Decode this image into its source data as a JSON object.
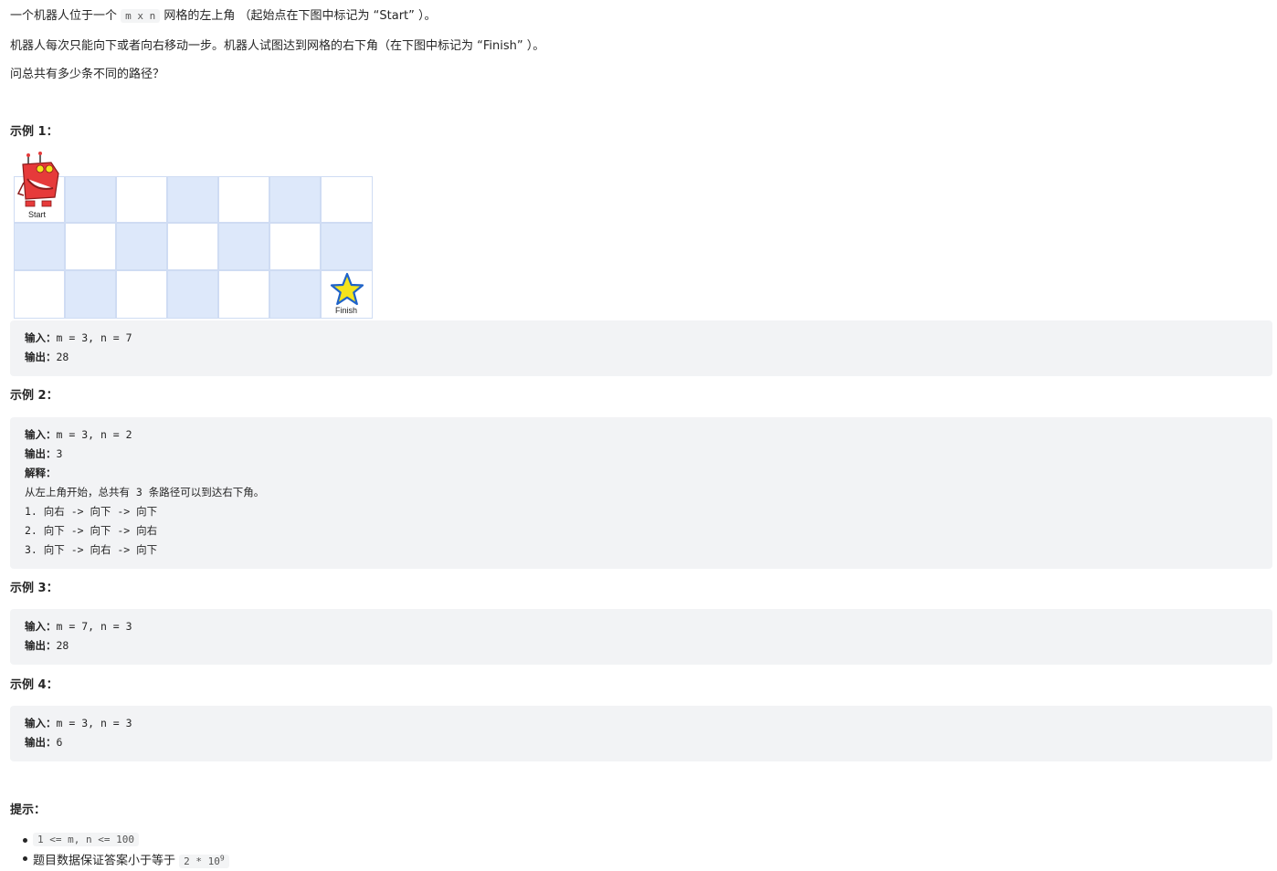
{
  "intro": {
    "p1_before": "一个机器人位于一个 ",
    "p1_code": "m x n",
    "p1_after": " 网格的左上角 （起始点在下图中标记为 “Start” ）。",
    "p2": "机器人每次只能向下或者向右移动一步。机器人试图达到网格的右下角（在下图中标记为 “Finish” ）。",
    "p3": "问总共有多少条不同的路径？"
  },
  "grid": {
    "start_label": "Start",
    "finish_label": "Finish",
    "cell_color": "#dde8fa",
    "robot_color": "#e63a3a",
    "star_color": "#f4e41c",
    "star_outline": "#1f63c9"
  },
  "examples": [
    {
      "title": "示例 1：",
      "lines": [
        {
          "label": "输入：",
          "text": "m = 3, n = 7"
        },
        {
          "label": "输出：",
          "text": "28"
        }
      ]
    },
    {
      "title": "示例 2：",
      "lines": [
        {
          "label": "输入：",
          "text": "m = 3, n = 2"
        },
        {
          "label": "输出：",
          "text": "3"
        },
        {
          "label": "解释：",
          "text": ""
        },
        {
          "label": "",
          "text": "从左上角开始，总共有 3 条路径可以到达右下角。"
        },
        {
          "label": "",
          "text": "1. 向右 -> 向下 -> 向下"
        },
        {
          "label": "",
          "text": "2. 向下 -> 向下 -> 向右"
        },
        {
          "label": "",
          "text": "3. 向下 -> 向右 -> 向下"
        }
      ]
    },
    {
      "title": "示例 3：",
      "lines": [
        {
          "label": "输入：",
          "text": "m = 7, n = 3"
        },
        {
          "label": "输出：",
          "text": "28"
        }
      ]
    },
    {
      "title": "示例 4：",
      "lines": [
        {
          "label": "输入：",
          "text": "m = 3, n = 3"
        },
        {
          "label": "输出：",
          "text": "6"
        }
      ]
    }
  ],
  "hints": {
    "title": "提示：",
    "item1_code": "1 <= m, n <= 100",
    "item2_text": "题目数据保证答案小于等于 ",
    "item2_code": "2 * 10",
    "item2_sup": "9"
  }
}
